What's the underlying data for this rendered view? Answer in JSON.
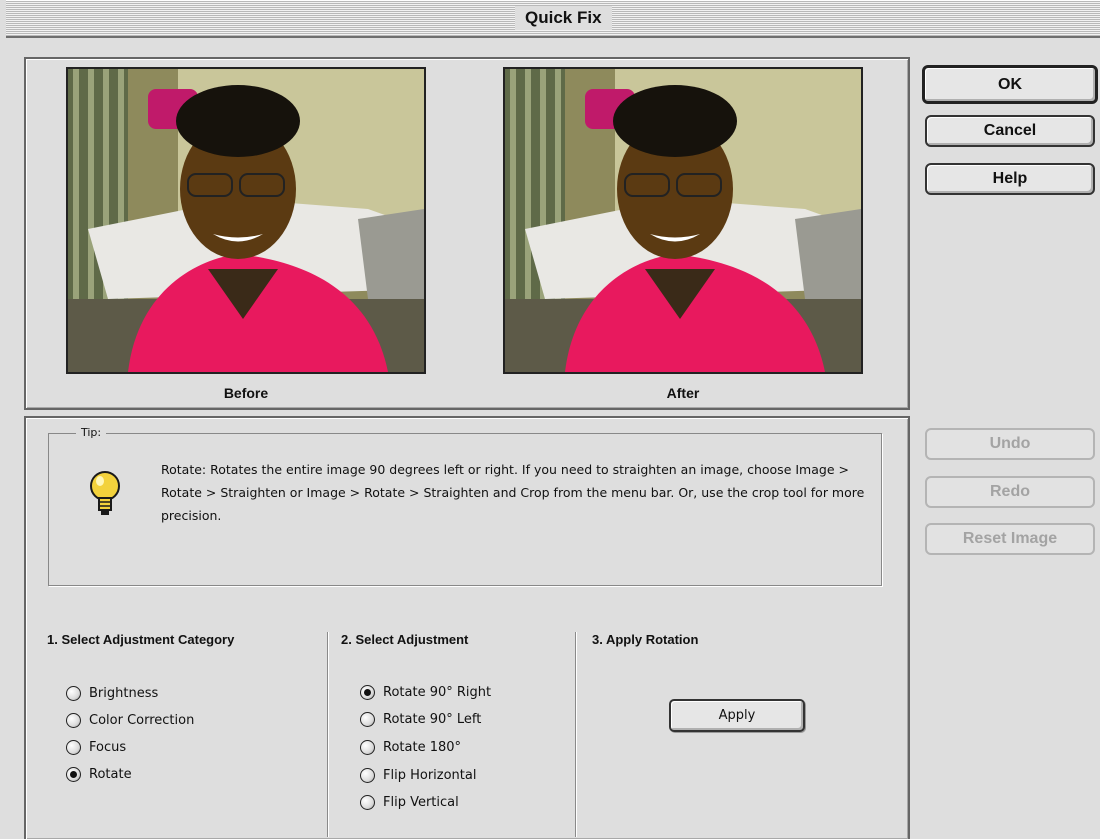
{
  "window": {
    "title": "Quick Fix"
  },
  "preview": {
    "before_label": "Before",
    "after_label": "After"
  },
  "buttons": {
    "ok": "OK",
    "cancel": "Cancel",
    "help": "Help",
    "undo": "Undo",
    "redo": "Redo",
    "reset": "Reset Image",
    "apply": "Apply"
  },
  "tip": {
    "label": "Tip:",
    "icon": "lightbulb-icon",
    "text": "Rotate: Rotates the entire image 90  degrees left or right. If you need to straighten an image, choose Image > Rotate > Straighten or Image > Rotate > Straighten and Crop from the menu bar. Or, use the crop tool for more precision."
  },
  "step1": {
    "heading": "1. Select Adjustment Category",
    "options": [
      "Brightness",
      "Color Correction",
      "Focus",
      "Rotate"
    ],
    "selected": "Rotate"
  },
  "step2": {
    "heading": "2. Select Adjustment",
    "options": [
      "Rotate 90° Right",
      "Rotate 90° Left",
      "Rotate 180°",
      "Flip Horizontal",
      "Flip Vertical"
    ],
    "selected": "Rotate 90° Right"
  },
  "step3": {
    "heading": "3. Apply Rotation"
  }
}
